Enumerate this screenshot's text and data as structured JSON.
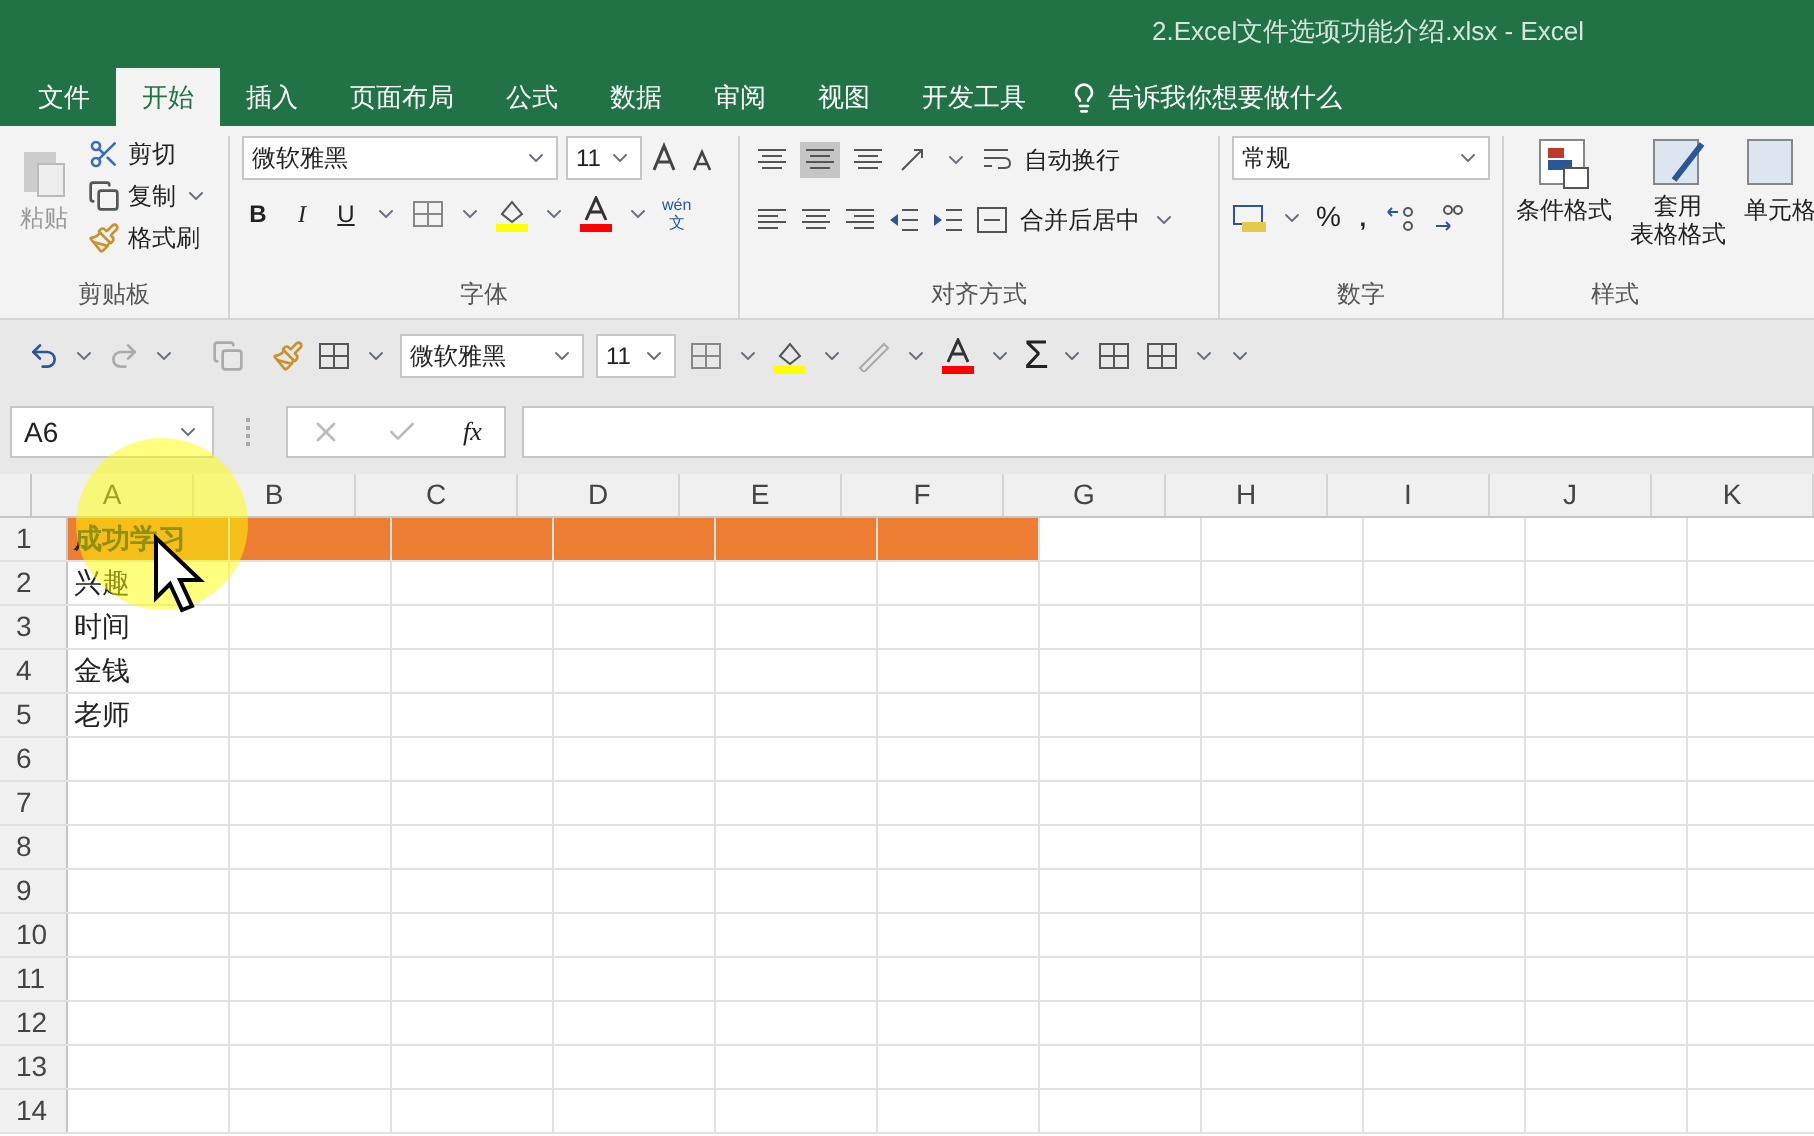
{
  "window": {
    "title": "2.Excel文件选项功能介绍.xlsx  -  Excel"
  },
  "tabs": [
    {
      "label": "文件",
      "selected": false
    },
    {
      "label": "开始",
      "selected": true
    },
    {
      "label": "插入",
      "selected": false
    },
    {
      "label": "页面布局",
      "selected": false
    },
    {
      "label": "公式",
      "selected": false
    },
    {
      "label": "数据",
      "selected": false
    },
    {
      "label": "审阅",
      "selected": false
    },
    {
      "label": "视图",
      "selected": false
    },
    {
      "label": "开发工具",
      "selected": false
    }
  ],
  "tell_me": "告诉我你想要做什么",
  "ribbon": {
    "clipboard": {
      "paste": "粘贴",
      "cut": "剪切",
      "copy": "复制",
      "format_painter": "格式刷",
      "label": "剪贴板"
    },
    "font": {
      "name": "微软雅黑",
      "size": "11",
      "bold": "B",
      "italic": "I",
      "underline": "U",
      "phonetic_top": "wén",
      "phonetic_bottom": "文",
      "label": "字体"
    },
    "alignment": {
      "wrap": "自动换行",
      "merge": "合并后居中",
      "label": "对齐方式"
    },
    "number": {
      "format": "常规",
      "percent": "%",
      "comma": ",",
      "label": "数字"
    },
    "styles": {
      "conditional": "条件格式",
      "table_top": "套用",
      "table_bottom": "表格格式",
      "cell": "单元格",
      "label": "样式"
    }
  },
  "toolbar": {
    "font": "微软雅黑",
    "size": "11",
    "sum": "Σ"
  },
  "formula_bar": {
    "name_box": "A6",
    "fx": "fx"
  },
  "columns": [
    "A",
    "B",
    "C",
    "D",
    "E",
    "F",
    "G",
    "H",
    "I",
    "J",
    "K"
  ],
  "rows": [
    {
      "number": "1",
      "cells": [
        {
          "text": "成功学习",
          "bold": true,
          "color": "#ed7d31"
        },
        {
          "color": "#ed7d31"
        },
        {
          "color": "#ed7d31"
        },
        {
          "color": "#ed7d31"
        },
        {
          "color": "#ed7d31"
        },
        {
          "color": "#ed7d31"
        }
      ]
    },
    {
      "number": "2",
      "cells": [
        {
          "text": "兴趣"
        }
      ]
    },
    {
      "number": "3",
      "cells": [
        {
          "text": "时间"
        }
      ]
    },
    {
      "number": "4",
      "cells": [
        {
          "text": "金钱"
        }
      ]
    },
    {
      "number": "5",
      "cells": [
        {
          "text": "老师"
        }
      ]
    },
    {
      "number": "6",
      "cells": []
    },
    {
      "number": "7",
      "cells": []
    },
    {
      "number": "8",
      "cells": []
    },
    {
      "number": "9",
      "cells": []
    },
    {
      "number": "10",
      "cells": []
    },
    {
      "number": "11",
      "cells": []
    },
    {
      "number": "12",
      "cells": []
    },
    {
      "number": "13",
      "cells": []
    },
    {
      "number": "14",
      "cells": []
    }
  ]
}
